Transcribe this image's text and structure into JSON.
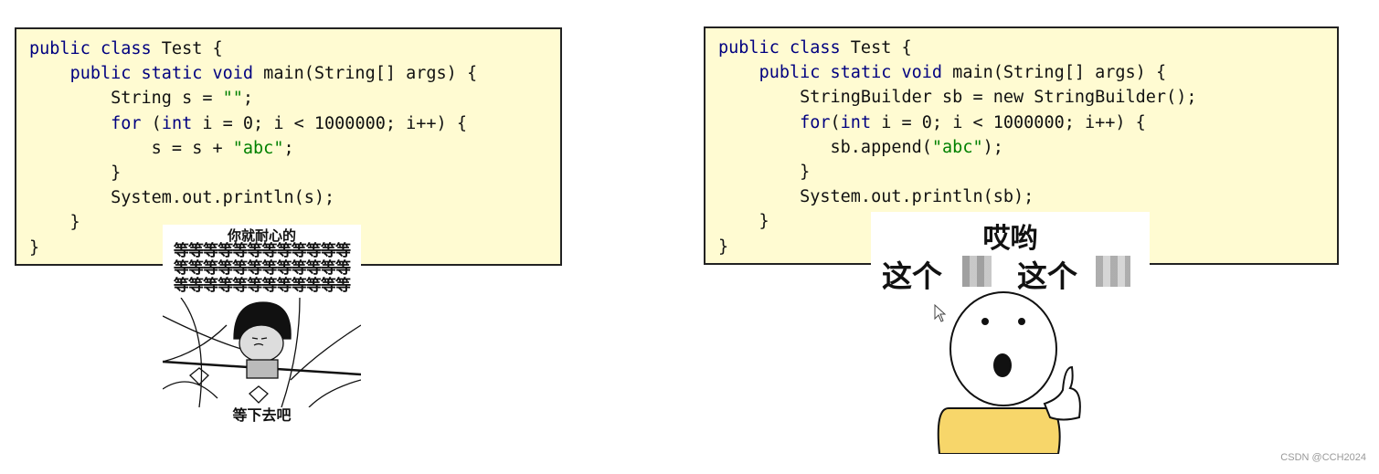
{
  "left_code": [
    [
      [
        "kw",
        "public class"
      ],
      [
        "t",
        " Test {"
      ]
    ],
    [
      [
        "t",
        "    "
      ],
      [
        "kw",
        "public static void"
      ],
      [
        "t",
        " main(String[] args) {"
      ]
    ],
    [
      [
        "t",
        "        String s = "
      ],
      [
        "str",
        "\"\""
      ],
      [
        "t",
        ";"
      ]
    ],
    [
      [
        "t",
        "        "
      ],
      [
        "kw",
        "for"
      ],
      [
        "t",
        " ("
      ],
      [
        "kw",
        "int"
      ],
      [
        "t",
        " i = 0; i < 1000000; i++) {"
      ]
    ],
    [
      [
        "t",
        "            s = s + "
      ],
      [
        "str",
        "\"abc\""
      ],
      [
        "t",
        ";"
      ]
    ],
    [
      [
        "t",
        "        }"
      ]
    ],
    [
      [
        "t",
        "        System.out.println(s);"
      ]
    ],
    [
      [
        "t",
        "    }"
      ]
    ],
    [
      [
        "t",
        "}"
      ]
    ]
  ],
  "right_code": [
    [
      [
        "kw",
        "public class"
      ],
      [
        "t",
        " Test {"
      ]
    ],
    [
      [
        "t",
        "    "
      ],
      [
        "kw",
        "public static void"
      ],
      [
        "t",
        " main(String[] args) {"
      ]
    ],
    [
      [
        "t",
        "        StringBuilder sb = new StringBuilder();"
      ]
    ],
    [
      [
        "t",
        "        "
      ],
      [
        "kw",
        "for"
      ],
      [
        "t",
        "("
      ],
      [
        "kw",
        "int"
      ],
      [
        "t",
        " i = 0; i < 1000000; i++) {"
      ]
    ],
    [
      [
        "t",
        "           sb.append("
      ],
      [
        "str",
        "\"abc\""
      ],
      [
        "t",
        ");"
      ]
    ],
    [
      [
        "t",
        "        }"
      ]
    ],
    [
      [
        "t",
        "        System.out.println(sb);"
      ]
    ],
    [
      [
        "t",
        "    }"
      ]
    ],
    [
      [
        "t",
        "}"
      ]
    ]
  ],
  "meme_left": {
    "top": "你就耐心的",
    "wait_row": "等等等等等等等等等等等等",
    "bottom": "等下去吧"
  },
  "meme_right": {
    "line1": "哎哟",
    "line2a": "这个",
    "line2b": "这个"
  },
  "watermark": "CSDN @CCH2024",
  "colors": {
    "code_bg": "#fffbd2",
    "keyword": "#000080",
    "string": "#008000",
    "shirt": "#f7d66a"
  }
}
